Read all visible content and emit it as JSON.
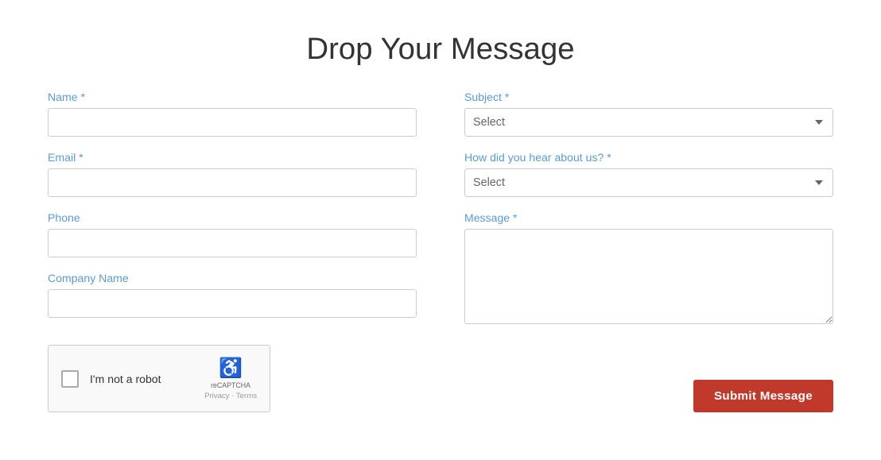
{
  "page": {
    "title": "Drop Your Message"
  },
  "form": {
    "name_label": "Name *",
    "name_placeholder": "",
    "email_label": "Email *",
    "email_placeholder": "",
    "phone_label": "Phone",
    "phone_placeholder": "",
    "company_label": "Company Name",
    "company_placeholder": "",
    "subject_label": "Subject *",
    "subject_placeholder": "Select",
    "hear_label": "How did you hear about us? *",
    "hear_placeholder": "Select",
    "message_label": "Message *",
    "message_placeholder": "",
    "captcha_label": "I'm not a robot",
    "captcha_brand": "reCAPTCHA",
    "captcha_links": "Privacy · Terms",
    "submit_label": "Submit Message"
  }
}
